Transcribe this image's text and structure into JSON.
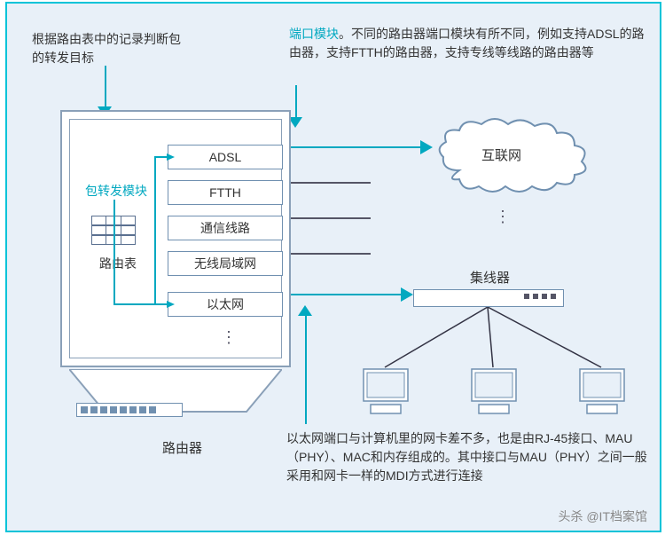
{
  "callouts": {
    "top_left": "根据路由表中的记录判断包的转发目标",
    "top_right_highlight": "端口模块",
    "top_right_rest": "。不同的路由器端口模块有所不同，例如支持ADSL的路由器，支持FTTH的路由器，支持专线等线路的路由器等",
    "bottom": "以太网端口与计算机里的网卡差不多，也是由RJ-45接口、MAU（PHY）、MAC和内存组成的。其中接口与MAU（PHY）之间一般采用和网卡一样的MDI方式进行连接"
  },
  "router": {
    "forward_module": "包转发模块",
    "route_table": "路由表",
    "port_modules": [
      "ADSL",
      "FTTH",
      "通信线路",
      "无线局域网",
      "以太网"
    ],
    "label": "路由器"
  },
  "cloud": {
    "label": "互联网"
  },
  "hub": {
    "label": "集线器"
  },
  "watermark": "头杀 @IT档案馆"
}
